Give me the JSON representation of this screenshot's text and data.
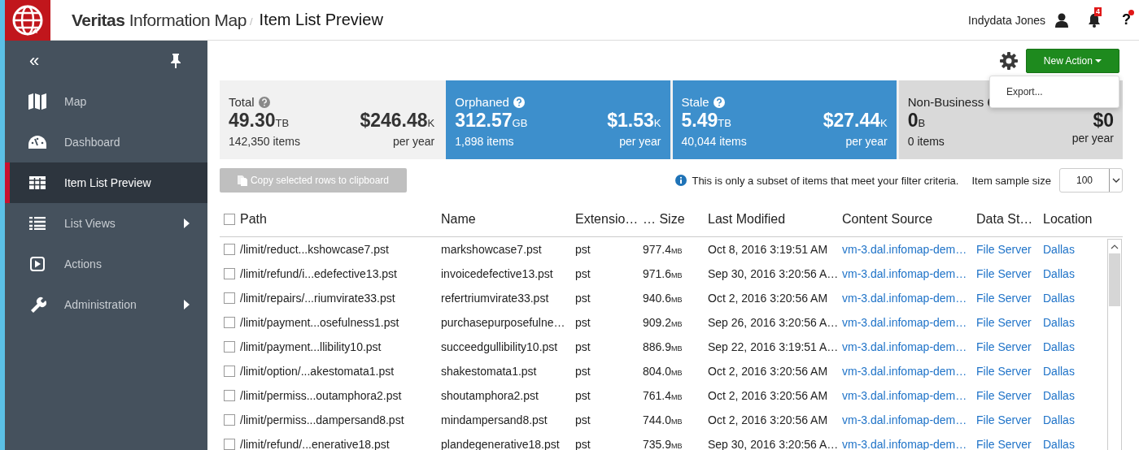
{
  "header": {
    "brand": "**Veritas** Information Map",
    "separator": "/",
    "page_title": "Item List Preview",
    "user_name": "Indydata Jones",
    "notification_count": "4",
    "help": {
      "label": "?",
      "alert": true
    }
  },
  "sidebar": {
    "collapse": "«",
    "items": [
      {
        "label": "Map",
        "selected": false,
        "has_submenu": false
      },
      {
        "label": "Dashboard",
        "selected": false,
        "has_submenu": false
      },
      {
        "label": "Item List Preview",
        "selected": true,
        "has_submenu": false
      },
      {
        "label": "List Views",
        "selected": false,
        "has_submenu": true
      },
      {
        "label": "Actions",
        "selected": false,
        "has_submenu": false
      },
      {
        "label": "Administration",
        "selected": false,
        "has_submenu": true
      }
    ]
  },
  "toolbar": {
    "new_action": "New Action",
    "menu": {
      "items": [
        "Export..."
      ]
    }
  },
  "summary": [
    {
      "kind": "plain",
      "label": "Total",
      "amount": "49.30",
      "unit": "TB",
      "items": "142,350 items",
      "cost": "$246.48",
      "cost_unit": "K",
      "period": "per year"
    },
    {
      "kind": "highlighted",
      "label": "Orphaned",
      "amount": "312.57",
      "unit": "GB",
      "items": "1,898 items",
      "cost": "$1.53",
      "cost_unit": "K",
      "period": "per year"
    },
    {
      "kind": "highlighted",
      "label": "Stale",
      "amount": "5.49",
      "unit": "TB",
      "items": "40,044 items",
      "cost": "$27.44",
      "cost_unit": "K",
      "period": "per year"
    },
    {
      "kind": "dimmed",
      "label": "Non-Business",
      "amount": "0",
      "unit": "B",
      "items": "0 items",
      "cost": "$0",
      "period": "per year"
    }
  ],
  "copy_button": {
    "label": "Copy selected rows to clipboard",
    "disabled": true
  },
  "notice": "This is only a subset of items that meet your filter criteria.",
  "sample_size": {
    "label": "Item sample size",
    "value": "100"
  },
  "table": {
    "columns": [
      "Path",
      "Name",
      "Extensio…",
      "… Size",
      "Last Modified",
      "Content Source",
      "Data St…",
      "Location"
    ],
    "all_checked": false,
    "rows": [
      {
        "checked": false,
        "path": "/limit/reduct...kshowcase7.pst",
        "name": "markshowcase7.pst",
        "ext": "pst",
        "size": "977.4",
        "unit": "MB",
        "modified": "Oct 8, 2016 3:19:51 AM",
        "source": "vm-3.dal.infomap-dem…",
        "store": "File Server",
        "location": "Dallas"
      },
      {
        "checked": false,
        "path": "/limit/refund/i...edefective13.pst",
        "name": "invoicedefective13.pst",
        "ext": "pst",
        "size": "971.6",
        "unit": "MB",
        "modified": "Sep 30, 2016 3:20:56 A…",
        "source": "vm-3.dal.infomap-dem…",
        "store": "File Server",
        "location": "Dallas"
      },
      {
        "checked": false,
        "path": "/limit/repairs/...riumvirate33.pst",
        "name": "refertriumvirate33.pst",
        "ext": "pst",
        "size": "940.6",
        "unit": "MB",
        "modified": "Oct 2, 2016 3:20:56 AM",
        "source": "vm-3.dal.infomap-dem…",
        "store": "File Server",
        "location": "Dallas"
      },
      {
        "checked": false,
        "path": "/limit/payment...osefulness1.pst",
        "name": "purchasepurposefulne…",
        "ext": "pst",
        "size": "909.2",
        "unit": "MB",
        "modified": "Sep 26, 2016 3:20:56 A…",
        "source": "vm-3.dal.infomap-dem…",
        "store": "File Server",
        "location": "Dallas"
      },
      {
        "checked": false,
        "path": "/limit/payment...llibility10.pst",
        "name": "succeedgullibility10.pst",
        "ext": "pst",
        "size": "886.9",
        "unit": "MB",
        "modified": "Sep 22, 2016 3:19:51 A…",
        "source": "vm-3.dal.infomap-dem…",
        "store": "File Server",
        "location": "Dallas"
      },
      {
        "checked": false,
        "path": "/limit/option/...akestomata1.pst",
        "name": "shakestomata1.pst",
        "ext": "pst",
        "size": "804.0",
        "unit": "MB",
        "modified": "Oct 2, 2016 3:20:56 AM",
        "source": "vm-3.dal.infomap-dem…",
        "store": "File Server",
        "location": "Dallas"
      },
      {
        "checked": false,
        "path": "/limit/permiss...outamphora2.pst",
        "name": "shoutamphora2.pst",
        "ext": "pst",
        "size": "761.4",
        "unit": "MB",
        "modified": "Oct 2, 2016 3:20:56 AM",
        "source": "vm-3.dal.infomap-dem…",
        "store": "File Server",
        "location": "Dallas"
      },
      {
        "checked": false,
        "path": "/limit/permiss...dampersand8.pst",
        "name": "mindampersand8.pst",
        "ext": "pst",
        "size": "744.0",
        "unit": "MB",
        "modified": "Oct 2, 2016 3:20:56 AM",
        "source": "vm-3.dal.infomap-dem…",
        "store": "File Server",
        "location": "Dallas"
      },
      {
        "checked": false,
        "path": "/limit/refund/...enerative18.pst",
        "name": "plandegenerative18.pst",
        "ext": "pst",
        "size": "735.9",
        "unit": "MB",
        "modified": "Sep 30, 2016 3:20:56 A…",
        "source": "vm-3.dal.infomap-dem…",
        "store": "File Server",
        "location": "Dallas"
      }
    ]
  }
}
